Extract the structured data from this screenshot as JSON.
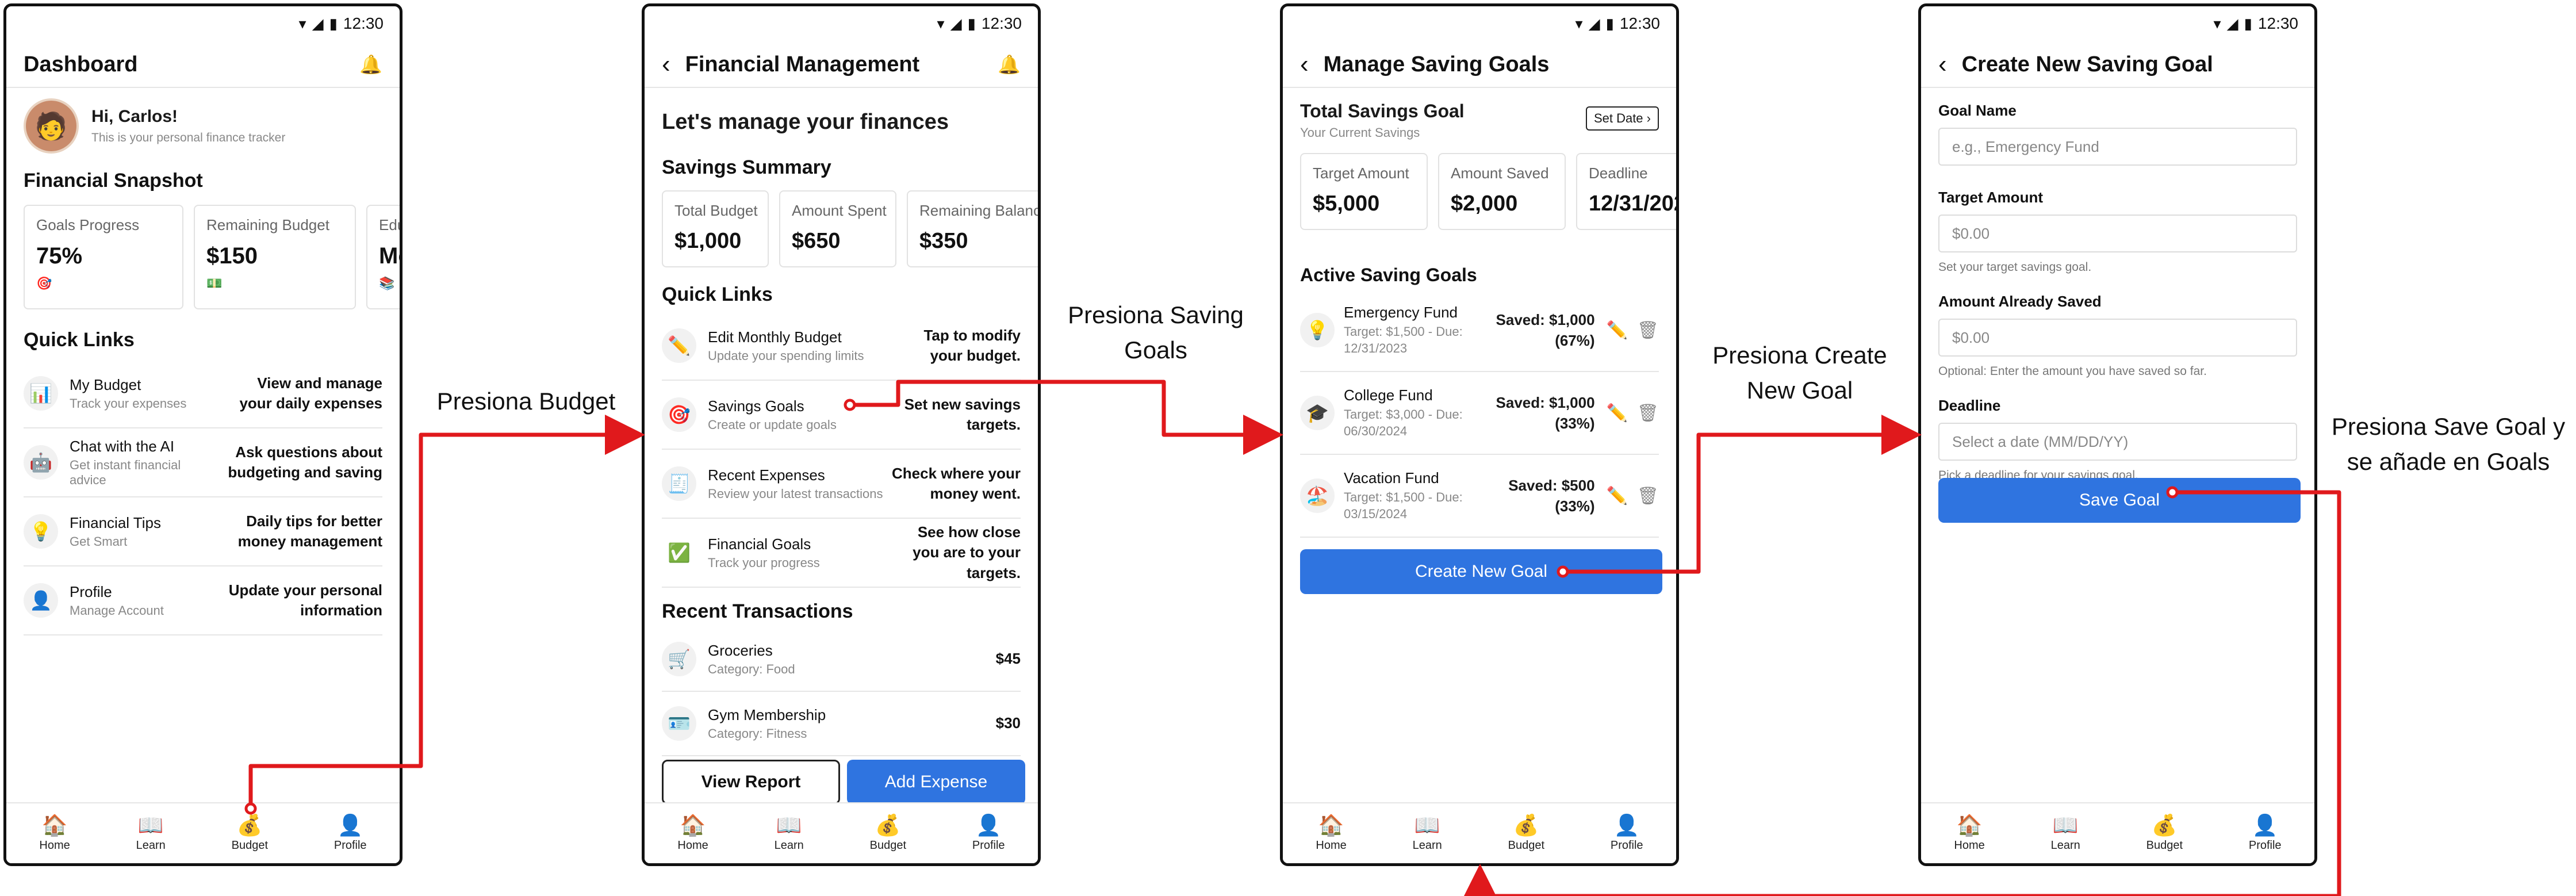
{
  "status": {
    "time": "12:30",
    "wifi_icon": "wifi-icon",
    "signal_icon": "signal-icon",
    "battery_icon": "battery-icon"
  },
  "tabbar": [
    "Home",
    "Learn",
    "Budget",
    "Profile"
  ],
  "screen1": {
    "title": "Dashboard",
    "greeting": "Hi, Carlos!",
    "greeting_sub": "This is your personal finance tracker",
    "snapshot_title": "Financial Snapshot",
    "cards": [
      {
        "label": "Goals Progress",
        "value": "75%",
        "icon": "target-icon"
      },
      {
        "label": "Remaining Budget",
        "value": "$150",
        "icon": "money-icon"
      },
      {
        "label": "Edu",
        "value": "Mo",
        "icon": "books-icon"
      }
    ],
    "quick_links_title": "Quick Links",
    "links": [
      {
        "title": "My Budget",
        "sub": "Track your expenses",
        "desc": "View and manage your daily expenses",
        "icon": "chart-icon"
      },
      {
        "title": "Chat with the AI",
        "sub": "Get instant financial advice",
        "desc": "Ask questions about budgeting and saving",
        "icon": "robot-icon"
      },
      {
        "title": "Financial Tips",
        "sub": "Get Smart",
        "desc": "Daily tips for better money management",
        "icon": "lightbulb-icon"
      },
      {
        "title": "Profile",
        "sub": "Manage Account",
        "desc": "Update your personal information",
        "icon": "person-icon"
      }
    ]
  },
  "screen2": {
    "title": "Financial Management",
    "heading": "Let's manage your finances",
    "summary_title": "Savings Summary",
    "cards": [
      {
        "label": "Total Budget",
        "value": "$1,000"
      },
      {
        "label": "Amount Spent",
        "value": "$650"
      },
      {
        "label": "Remaining Balance",
        "value": "$350"
      }
    ],
    "quick_links_title": "Quick Links",
    "links": [
      {
        "title": "Edit Monthly Budget",
        "sub": "Update your spending limits",
        "desc": "Tap to modify your budget.",
        "icon": "pencil-icon"
      },
      {
        "title": "Savings Goals",
        "sub": "Create or update goals",
        "desc": "Set new savings targets.",
        "icon": "target-icon"
      },
      {
        "title": "Recent Expenses",
        "sub": "Review your latest transactions",
        "desc": "Check where your money went.",
        "icon": "receipt-icon"
      },
      {
        "title": "Financial Goals",
        "sub": "Track your progress",
        "desc": "See how close you are to your targets.",
        "icon": "checkmark-icon"
      }
    ],
    "transactions_title": "Recent Transactions",
    "transactions": [
      {
        "title": "Groceries",
        "sub": "Category: Food",
        "amount": "$45",
        "icon": "cart-icon"
      },
      {
        "title": "Gym Membership",
        "sub": "Category: Fitness",
        "amount": "$30",
        "icon": "card-icon"
      }
    ],
    "view_report": "View Report",
    "add_expense": "Add Expense"
  },
  "screen3": {
    "title": "Manage Saving Goals",
    "total_title": "Total Savings Goal",
    "total_sub": "Your Current Savings",
    "set_date": "Set Date",
    "cards": [
      {
        "label": "Target Amount",
        "value": "$5,000"
      },
      {
        "label": "Amount Saved",
        "value": "$2,000"
      },
      {
        "label": "Deadline",
        "value": "12/31/202"
      }
    ],
    "active_title": "Active Saving Goals",
    "goals": [
      {
        "name": "Emergency Fund",
        "sub": "Target: $1,500 - Due: 12/31/2023",
        "saved": "Saved: $1,000",
        "pct": "(67%)",
        "icon": "lightbulb-icon"
      },
      {
        "name": "College Fund",
        "sub": "Target: $3,000 - Due: 06/30/2024",
        "saved": "Saved: $1,000",
        "pct": "(33%)",
        "icon": "graduation-cap-icon"
      },
      {
        "name": "Vacation Fund",
        "sub": "Target: $1,500 - Due: 03/15/2024",
        "saved": "Saved: $500",
        "pct": "(33%)",
        "icon": "beach-icon"
      }
    ],
    "create_btn": "Create New Goal"
  },
  "screen4": {
    "title": "Create New Saving Goal",
    "name_label": "Goal Name",
    "name_placeholder": "e.g., Emergency Fund",
    "target_label": "Target Amount",
    "target_placeholder": "$0.00",
    "target_helper": "Set your target savings goal.",
    "saved_label": "Amount Already Saved",
    "saved_placeholder": "$0.00",
    "saved_helper": "Optional: Enter the amount you have saved so far.",
    "deadline_label": "Deadline",
    "deadline_placeholder": "Select a date (MM/DD/YY)",
    "deadline_helper": "Pick a deadline for your savings goal.",
    "save_btn": "Save Goal"
  },
  "captions": {
    "c1": "Presiona Budget",
    "c2a": "Presiona Saving",
    "c2b": "Goals",
    "c3a": "Presiona Create",
    "c3b": "New Goal",
    "c4a": "Presiona Save Goal y",
    "c4b": "se añade en Goals"
  },
  "colors": {
    "accent": "#2f74e0",
    "flow_arrow": "#e0191c"
  }
}
